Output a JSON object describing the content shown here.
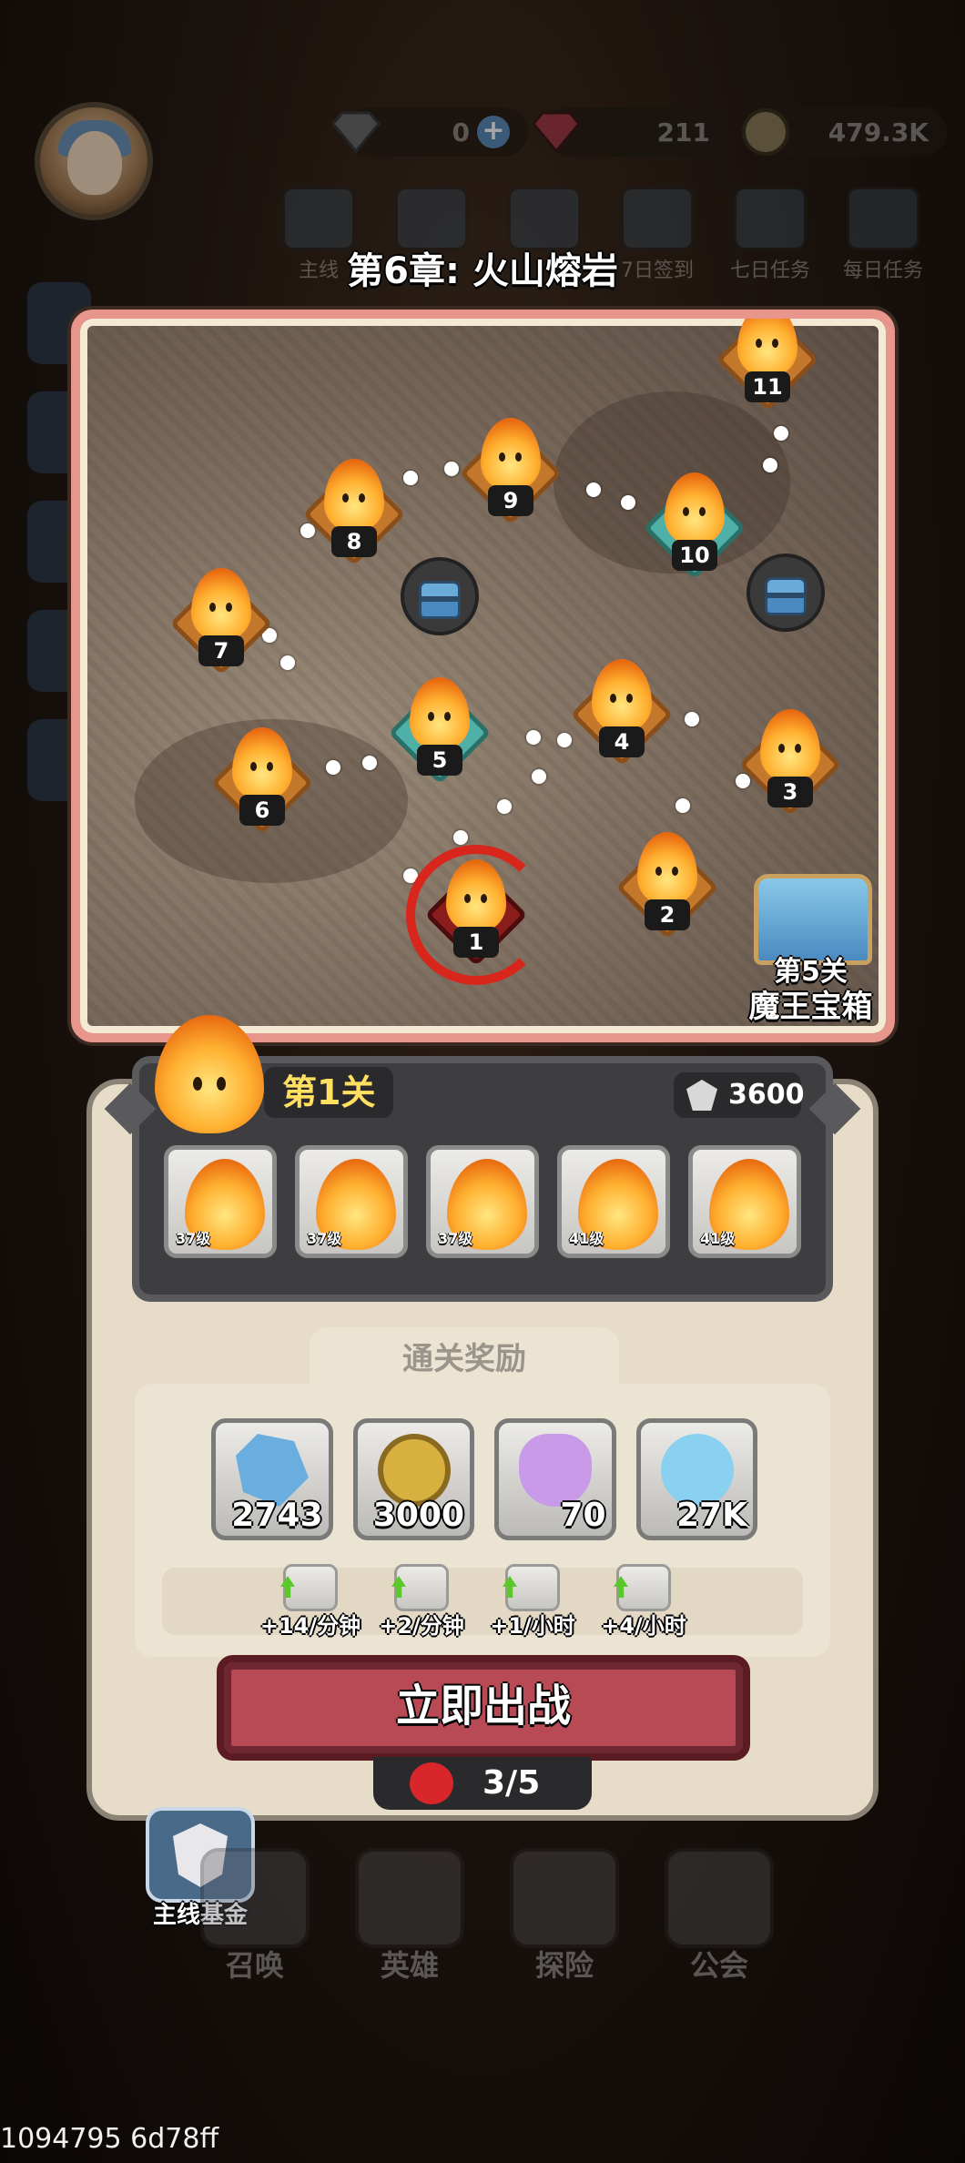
{
  "resources": {
    "gems_free": "0",
    "gems_premium": "211",
    "coins": "479.3K"
  },
  "top_icons": [
    "主线",
    "",
    "",
    "7日签到",
    "七日任务",
    "每日任务"
  ],
  "chapter": {
    "title": "第6章: 火山熔岩"
  },
  "map": {
    "nodes": [
      {
        "num": "1",
        "style": "red"
      },
      {
        "num": "2",
        "style": "orange"
      },
      {
        "num": "3",
        "style": "orange"
      },
      {
        "num": "4",
        "style": "orange"
      },
      {
        "num": "5",
        "style": "teal"
      },
      {
        "num": "6",
        "style": "orange"
      },
      {
        "num": "7",
        "style": "orange"
      },
      {
        "num": "8",
        "style": "orange"
      },
      {
        "num": "9",
        "style": "orange"
      },
      {
        "num": "10",
        "style": "teal"
      },
      {
        "num": "11",
        "style": "orange"
      }
    ],
    "boss_chest": {
      "line1": "第5关",
      "line2": "魔王宝箱"
    }
  },
  "stage": {
    "title": "第1关",
    "power": "3600",
    "enemies": [
      {
        "level": "37级"
      },
      {
        "level": "37级"
      },
      {
        "level": "37级"
      },
      {
        "level": "41级"
      },
      {
        "level": "41级"
      }
    ]
  },
  "rewards": {
    "tab_label": "通关奖励",
    "items": [
      {
        "icon": "crystal-icon",
        "value": "2743"
      },
      {
        "icon": "coin-icon",
        "value": "3000"
      },
      {
        "icon": "purple-potion-icon",
        "value": "70"
      },
      {
        "icon": "blue-potion-icon",
        "value": "27K"
      }
    ],
    "rates": [
      "+14/分钟",
      "+2/分钟",
      "+1/小时",
      "+4/小时"
    ]
  },
  "battle_button": "立即出战",
  "stamina": "3/5",
  "fund": "主线基金",
  "bottom_nav": [
    "召唤",
    "英雄",
    "探险",
    "公会"
  ],
  "footer_id": "1094795 6d78ff"
}
